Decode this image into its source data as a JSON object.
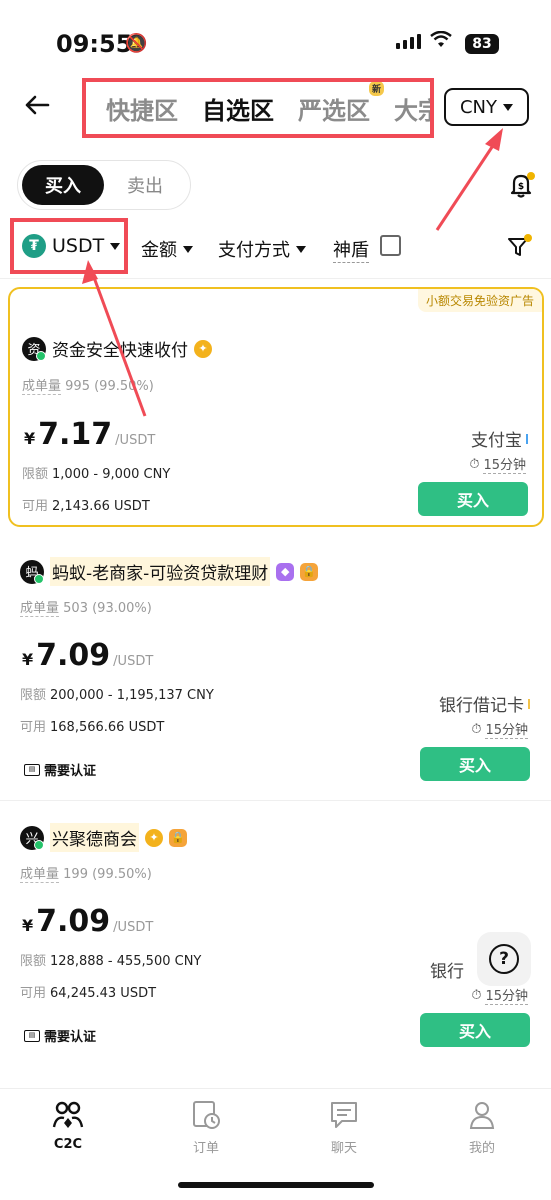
{
  "status_bar": {
    "time": "09:55",
    "battery": "83"
  },
  "header": {
    "tabs": [
      {
        "label": "快捷区"
      },
      {
        "label": "自选区"
      },
      {
        "label": "严选区",
        "badge": "新"
      },
      {
        "label": "大宗"
      }
    ],
    "active_tab": "自选区",
    "currency": "CNY"
  },
  "trade_toggle": {
    "buy": "买入",
    "sell": "卖出",
    "active": "买入"
  },
  "filters": {
    "asset": "USDT",
    "amount": "金额",
    "payment": "支付方式",
    "shield": "神盾"
  },
  "ads": [
    {
      "tag": "小额交易免验资广告",
      "avatar_char": "资",
      "merchant": "资金安全快速收付",
      "stats_label": "成单量",
      "stats_value": "995 (99.50%)",
      "currency_symbol": "¥",
      "price": "7.17",
      "unit": "/USDT",
      "limit_label": "限额",
      "limit": "1,000 - 9,000 CNY",
      "avail_label": "可用",
      "available": "2,143.66 USDT",
      "payment": "支付宝",
      "payment_color": "#4aa3f0",
      "time_limit": "15分钟",
      "button": "买入"
    },
    {
      "avatar_char": "蚂",
      "merchant": "蚂蚁-老商家-可验资贷款理财",
      "stats_label": "成单量",
      "stats_value": "503 (93.00%)",
      "currency_symbol": "¥",
      "price": "7.09",
      "unit": "/USDT",
      "limit_label": "限额",
      "limit": "200,000 - 1,195,137 CNY",
      "avail_label": "可用",
      "available": "168,566.66 USDT",
      "payment": "银行借记卡",
      "payment_color": "#f3c34a",
      "time_limit": "15分钟",
      "kyc": "需要认证",
      "button": "买入"
    },
    {
      "avatar_char": "兴",
      "merchant": "兴聚德商会",
      "stats_label": "成单量",
      "stats_value": "199 (99.50%)",
      "currency_symbol": "¥",
      "price": "7.09",
      "unit": "/USDT",
      "limit_label": "限额",
      "limit": "128,888 - 455,500 CNY",
      "avail_label": "可用",
      "available": "64,245.43 USDT",
      "payment": "银行",
      "time_limit": "15分钟",
      "kyc": "需要认证",
      "button": "买入"
    }
  ],
  "bottom_nav": [
    {
      "label": "C2C"
    },
    {
      "label": "订单"
    },
    {
      "label": "聊天"
    },
    {
      "label": "我的"
    }
  ],
  "colors": {
    "accent_green": "#2fbf84",
    "highlight_border": "#f0c020",
    "annotation_red": "#f04b56"
  }
}
